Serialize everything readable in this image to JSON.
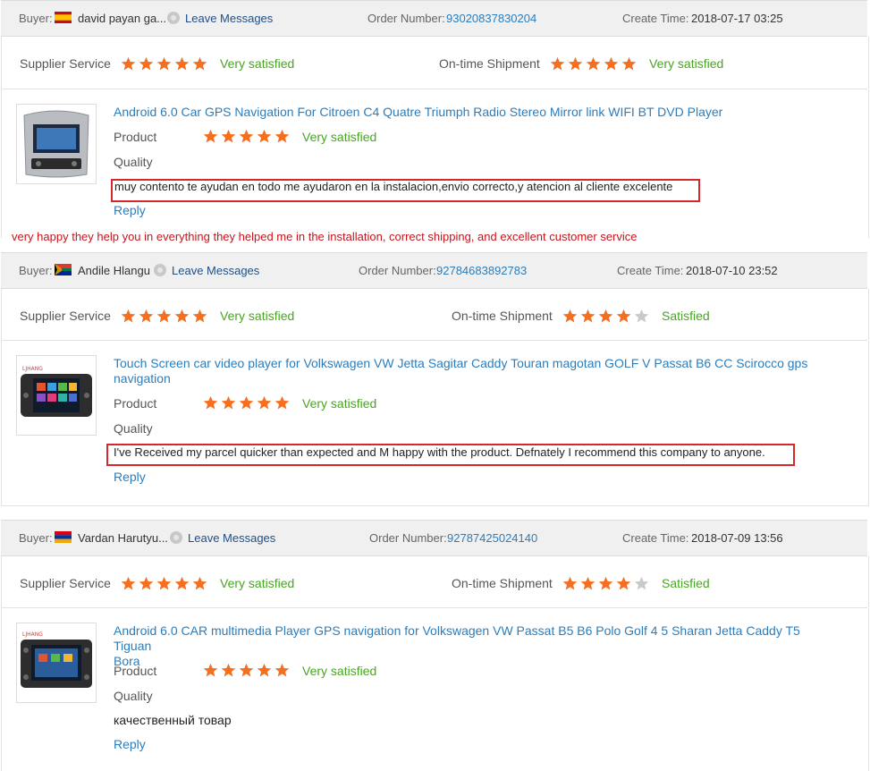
{
  "labels": {
    "buyer": "Buyer:",
    "order_number": "Order Number:",
    "create_time": "Create Time:",
    "supplier_service": "Supplier Service",
    "ontime_shipment": "On-time Shipment",
    "product": "Product",
    "quality": "Quality",
    "reply": "Reply",
    "leave_messages": "Leave Messages"
  },
  "colors": {
    "star_on": "#f36f21",
    "star_off": "#c9c9c9",
    "green_text": "#47a61f",
    "link": "#2b7dbc",
    "red_box": "#d4282c",
    "red_translation": "#c4161c"
  },
  "reviews": [
    {
      "buyer_name": "david payan ga...",
      "flag": "spain-flag",
      "order_number": "93020837830204",
      "create_time": "2018-07-17 03:25",
      "supplier_stars": 5,
      "supplier_text": "Very satisfied",
      "shipment_stars": 5,
      "shipment_text": "Very satisfied",
      "product_title": "Android 6.0 Car GPS Navigation For Citroen C4 Quatre Triumph Radio Stereo Mirror link WIFI BT DVD Player",
      "product_stars": 5,
      "product_text": "Very satisfied",
      "comment": "muy contento te ayudan en todo me ayudaron en la instalacion,envio correcto,y atencion al cliente excelente",
      "translation": "very happy they help you in everything they helped me in the installation, correct shipping, and excellent customer service"
    },
    {
      "buyer_name": "Andile Hlangu",
      "flag": "south-africa-flag",
      "order_number": "92784683892783",
      "create_time": "2018-07-10 23:52",
      "supplier_stars": 5,
      "supplier_text": "Very satisfied",
      "shipment_stars": 4,
      "shipment_text": "Satisfied",
      "product_title_line1": "Touch Screen car video player for Volkswagen VW Jetta Sagitar Caddy Touran magotan GOLF V Passat B6 CC Scirocco gps",
      "product_title_line2": "navigation",
      "product_stars": 5,
      "product_text": "Very satisfied",
      "comment": "I've Received my parcel quicker than expected and M happy with the product. Defnately I recommend this company to anyone."
    },
    {
      "buyer_name": "Vardan Harutyu...",
      "flag": "armenia-flag",
      "order_number": "92787425024140",
      "create_time": "2018-07-09 13:56",
      "supplier_stars": 5,
      "supplier_text": "Very satisfied",
      "shipment_stars": 4,
      "shipment_text": "Satisfied",
      "product_title_line1": "Android 6.0 CAR multimedia Player GPS navigation for Volkswagen VW Passat B5 B6 Polo Golf 4 5 Sharan Jetta Caddy T5 Tiguan",
      "product_title_line2": "Bora",
      "product_stars": 5,
      "product_text": "Very satisfied",
      "comment": "качественный товар"
    }
  ]
}
